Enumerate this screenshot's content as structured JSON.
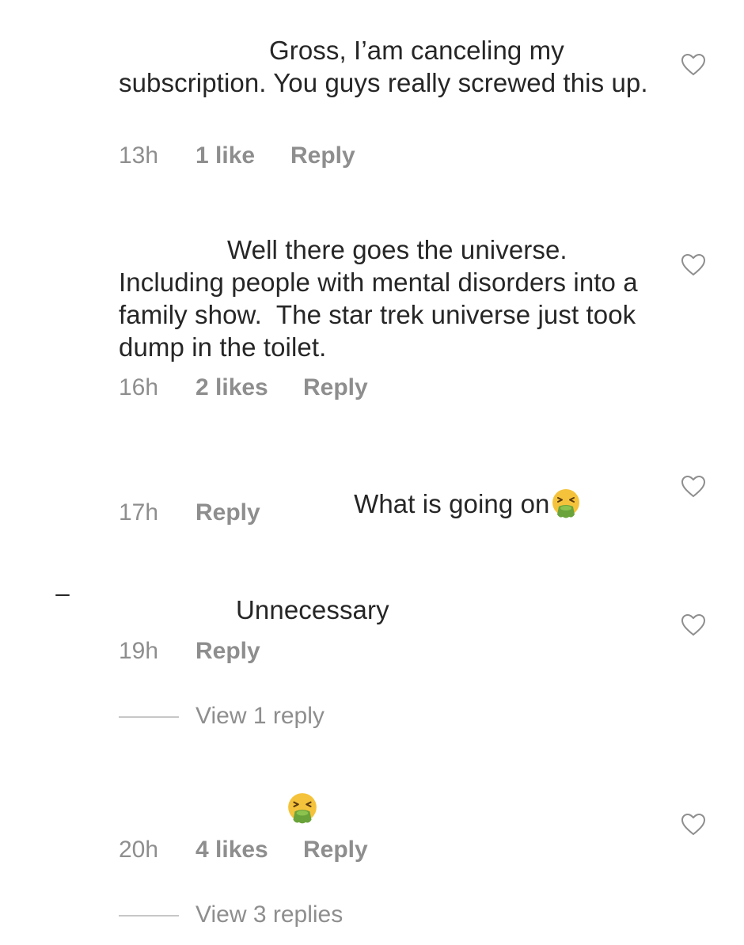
{
  "comments": [
    {
      "text": "Gross, I’am canceling my\nsubscription. You guys really screwed this up.",
      "time": "13h",
      "likes": "1 like",
      "reply": "Reply"
    },
    {
      "text": "Well there goes the universe.\nIncluding people with mental disorders into a family show.  The star trek universe just took dump in the toilet.",
      "time": "16h",
      "likes": "2 likes",
      "reply": "Reply"
    },
    {
      "text": "What is going on",
      "emoji": "nauseated-face-emoji",
      "time": "17h",
      "reply": "Reply"
    },
    {
      "text": "Unnecessary",
      "time": "19h",
      "reply": "Reply",
      "view_replies": "View 1 reply"
    },
    {
      "emoji": "nauseated-face-emoji",
      "time": "20h",
      "likes": "4 likes",
      "reply": "Reply",
      "view_replies": "View 3 replies"
    }
  ],
  "icons": {
    "like": "heart-outline-icon"
  },
  "colors": {
    "text": "#262626",
    "meta": "#8e8e8e",
    "rule": "#c7c7c7",
    "emoji_face": "#f5c33b",
    "emoji_vomit": "#6aa33a"
  }
}
